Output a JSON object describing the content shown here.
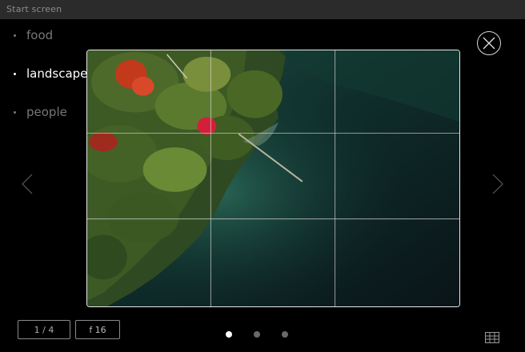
{
  "window": {
    "title": "Start screen"
  },
  "nav": {
    "items": [
      {
        "label": "food",
        "active": false
      },
      {
        "label": "landscape",
        "active": true
      },
      {
        "label": "people",
        "active": false
      }
    ]
  },
  "viewer": {
    "counter": "1 / 4",
    "fstop": "f 16",
    "current_page": 1,
    "page_count": 3
  },
  "icons": {
    "close": "close-icon",
    "prev": "chevron-left-icon",
    "next": "chevron-right-icon",
    "grid": "grid-icon"
  },
  "colors": {
    "background": "#000000",
    "titlebar": "#2b2b2b",
    "active_text": "#ffffff",
    "inactive_text": "#777777"
  }
}
